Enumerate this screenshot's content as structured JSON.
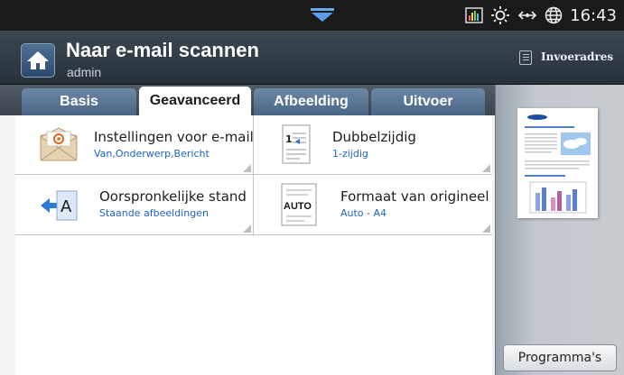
{
  "status": {
    "time": "16:43"
  },
  "header": {
    "title": "Naar e-mail scannen",
    "user": "admin",
    "address_label": "Invoeradres"
  },
  "tabs": [
    {
      "label": "Basis",
      "active": false
    },
    {
      "label": "Geavanceerd",
      "active": true
    },
    {
      "label": "Afbeelding",
      "active": false
    },
    {
      "label": "Uitvoer",
      "active": false
    }
  ],
  "options": [
    {
      "label": "Instellingen voor e-mail",
      "value": "Van,Onderwerp,Bericht",
      "icon": "email-envelope-icon"
    },
    {
      "label": "Dubbelzijdig",
      "value": "1-zijdig",
      "icon": "duplex-page-icon"
    },
    {
      "label": "Oorspronkelijke stand",
      "value": "Staande afbeeldingen",
      "icon": "orientation-arrow-icon"
    },
    {
      "label": "Formaat van origineel",
      "value": "Auto - A4",
      "icon": "auto-size-icon"
    }
  ],
  "preview": {
    "icon": "document-preview-thumbnail"
  },
  "program_button": {
    "label": "Programma's"
  },
  "colors": {
    "accent_blue": "#1c63c7",
    "titlebar": "#2e3943",
    "tab_blue": "#5c7899"
  }
}
